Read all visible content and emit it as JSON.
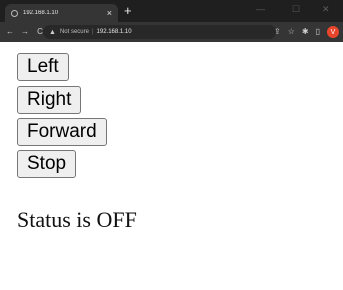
{
  "browser": {
    "tab": {
      "title": "192.168.1.10",
      "close": "×"
    },
    "new_tab": "+",
    "window_controls": {
      "minimize": "—",
      "maximize": "☐",
      "close": "✕"
    },
    "nav": {
      "back": "←",
      "forward": "→",
      "reload": "C"
    },
    "address": {
      "security_icon": "warning-triangle-icon",
      "security_label": "Not secure",
      "separator": "|",
      "url": "192.168.1.10"
    },
    "toolbar_icons": [
      "share-icon",
      "star-icon",
      "extensions-icon",
      "sidepanel-icon"
    ],
    "profile_initial": "V"
  },
  "page": {
    "buttons": [
      {
        "label": "Left"
      },
      {
        "label": "Right"
      },
      {
        "label": "Forward"
      },
      {
        "label": "Stop"
      }
    ],
    "status_text": "Status is OFF"
  }
}
